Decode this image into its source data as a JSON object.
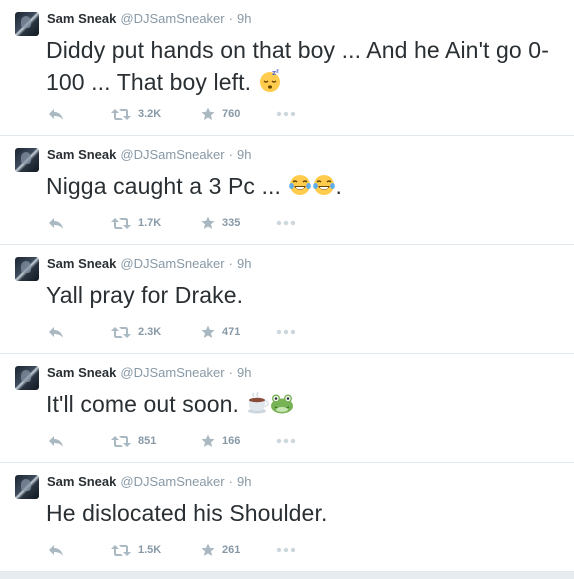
{
  "tweets": [
    {
      "name": "Sam Sneak",
      "handle": "@DJSamSneaker",
      "time": "9h",
      "text": "Diddy put hands on that boy ... And he Ain't go 0-100 ... That boy left. ",
      "emojis": [
        "sleeping-face"
      ],
      "retweets": "3.2K",
      "favorites": "760"
    },
    {
      "name": "Sam Sneak",
      "handle": "@DJSamSneaker",
      "time": "9h",
      "text": "Nigga caught a 3 Pc ... ",
      "emojis": [
        "tears-of-joy",
        "tears-of-joy"
      ],
      "trailing": ".",
      "retweets": "1.7K",
      "favorites": "335"
    },
    {
      "name": "Sam Sneak",
      "handle": "@DJSamSneaker",
      "time": "9h",
      "text": "Yall pray for Drake.",
      "emojis": [],
      "retweets": "2.3K",
      "favorites": "471"
    },
    {
      "name": "Sam Sneak",
      "handle": "@DJSamSneaker",
      "time": "9h",
      "text": "It'll come out soon. ",
      "emojis": [
        "hot-beverage",
        "frog-face"
      ],
      "retweets": "851",
      "favorites": "166"
    },
    {
      "name": "Sam Sneak",
      "handle": "@DJSamSneaker",
      "time": "9h",
      "text": "He dislocated his Shoulder.",
      "emojis": [],
      "retweets": "1.5K",
      "favorites": "261"
    }
  ],
  "dot": "·",
  "colors": {
    "name": "#292f33",
    "meta": "#8899a6",
    "action": "#aab8c2",
    "border": "#e1e8ed"
  }
}
